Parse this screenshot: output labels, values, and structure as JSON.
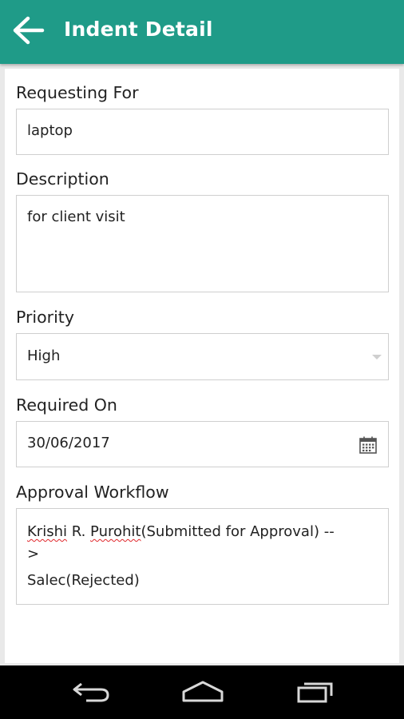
{
  "header": {
    "title": "Indent Detail",
    "back_icon": "back-arrow-icon",
    "bar_color": "#1f9b88"
  },
  "form": {
    "requesting_for": {
      "label": "Requesting For",
      "value": "laptop"
    },
    "description": {
      "label": "Description",
      "value": "for client visit"
    },
    "priority": {
      "label": "Priority",
      "value": "High",
      "icon": "chevron-down-icon"
    },
    "required_on": {
      "label": "Required On",
      "value": "30/06/2017",
      "icon": "calendar-icon"
    },
    "approval_workflow": {
      "label": "Approval Workflow",
      "line1": {
        "first_name": "Krishi",
        "middle": " R. ",
        "last_name": "Purohit",
        "status": "(Submitted for Approval) --"
      },
      "line2": ">",
      "line3": "Salec(Rejected)"
    }
  },
  "nav": {
    "back_icon": "nav-back-icon",
    "home_icon": "nav-home-icon",
    "recents_icon": "nav-recents-icon"
  }
}
